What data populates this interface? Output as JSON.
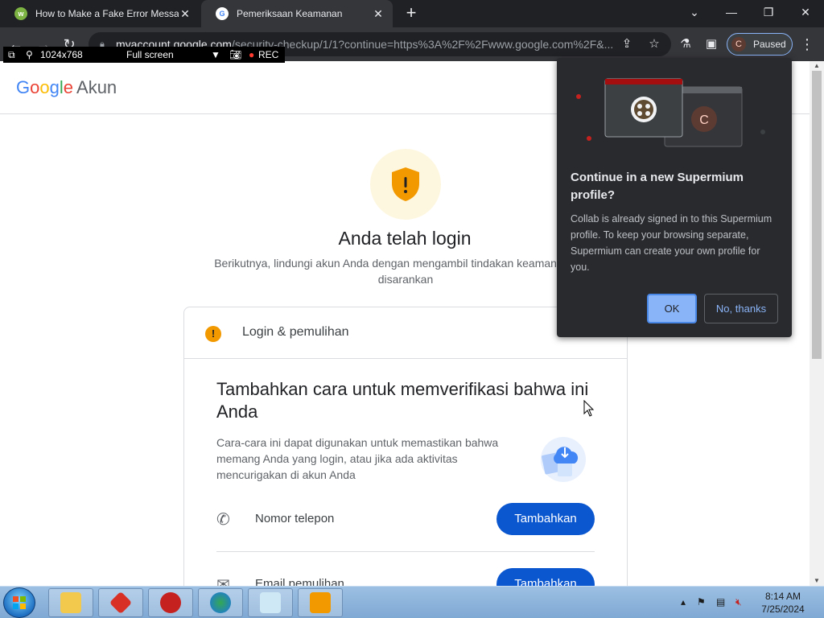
{
  "tabs": [
    {
      "title": "How to Make a Fake Error Messa",
      "favicon": "wikihow-icon",
      "active": false
    },
    {
      "title": "Pemeriksaan Keamanan",
      "favicon": "google-icon",
      "active": true
    }
  ],
  "omnibox": {
    "url_host": "myaccount.google.com",
    "url_path": "/security-checkup/1/1?continue=https%3A%2F%2Fwww.google.com%2F&..."
  },
  "profile_button": {
    "avatar_letter": "C",
    "label": "Paused"
  },
  "recorder": {
    "resolution": "1024x768",
    "mode": "Full screen",
    "rec_label": "REC"
  },
  "header": {
    "logo_text": "Google",
    "product": "Akun"
  },
  "hero": {
    "title": "Anda telah login",
    "subtitle": "Berikutnya, lindungi akun Anda dengan mengambil tindakan keamanan yang disarankan"
  },
  "card": {
    "section_title": "Login & pemulihan",
    "heading": "Tambahkan cara untuk memverifikasi bahwa ini Anda",
    "description": "Cara-cara ini dapat digunakan untuk memastikan bahwa memang Anda yang login, atau jika ada aktivitas mencurigakan di akun Anda",
    "rows": [
      {
        "label": "Nomor telepon",
        "icon": "phone-icon",
        "button": "Tambahkan"
      },
      {
        "label": "Email pemulihan",
        "icon": "mail-icon",
        "button": "Tambahkan"
      }
    ]
  },
  "popup": {
    "title": "Continue in a new Supermium profile?",
    "body": "Collab is already signed in to this Supermium profile. To keep your browsing separate, Supermium can create your own profile for you.",
    "ok": "OK",
    "cancel": "No, thanks",
    "avatar_letter": "C"
  },
  "taskbar": {
    "time": "8:14 AM",
    "date": "7/25/2024"
  },
  "colors": {
    "chrome_dark": "#202124",
    "toolbar": "#35363a",
    "google_blue": "#0b57d0",
    "warning": "#f29900",
    "popup_bg": "#292a2d",
    "accent_blue": "#8ab4f8"
  }
}
